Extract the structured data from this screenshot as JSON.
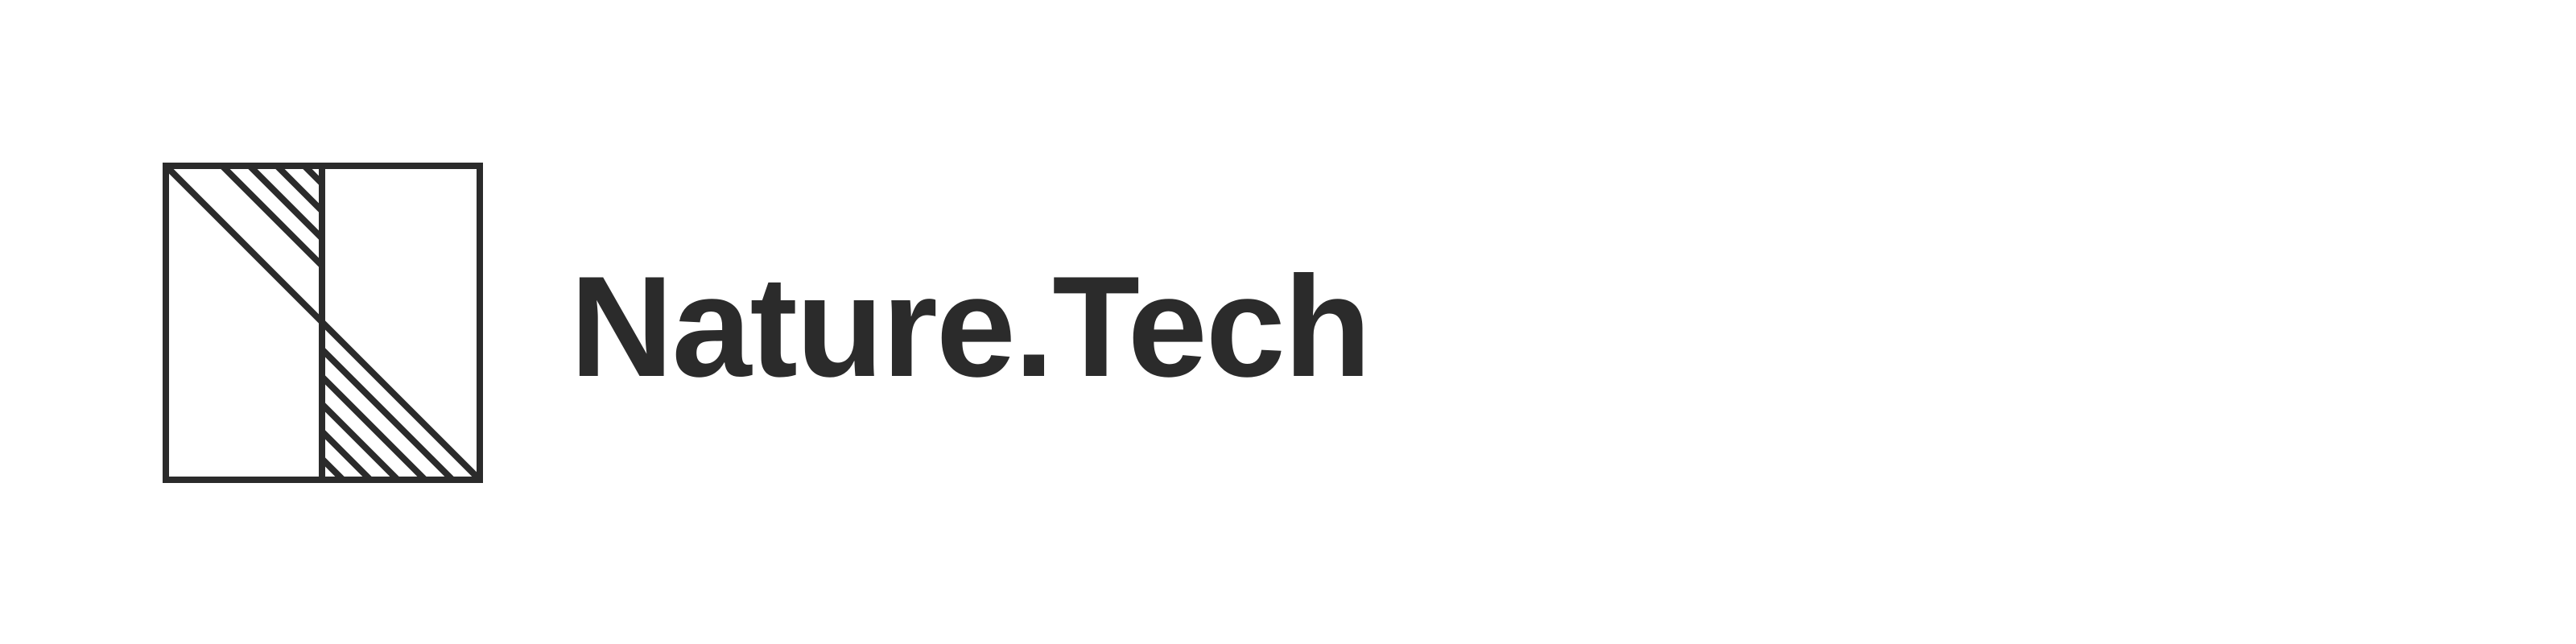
{
  "brand": {
    "name": "Nature.Tech",
    "ink_color": "#2b2b2b",
    "background_color": "#ffffff"
  },
  "logo": {
    "icon": "hatched-square-logo-icon"
  }
}
